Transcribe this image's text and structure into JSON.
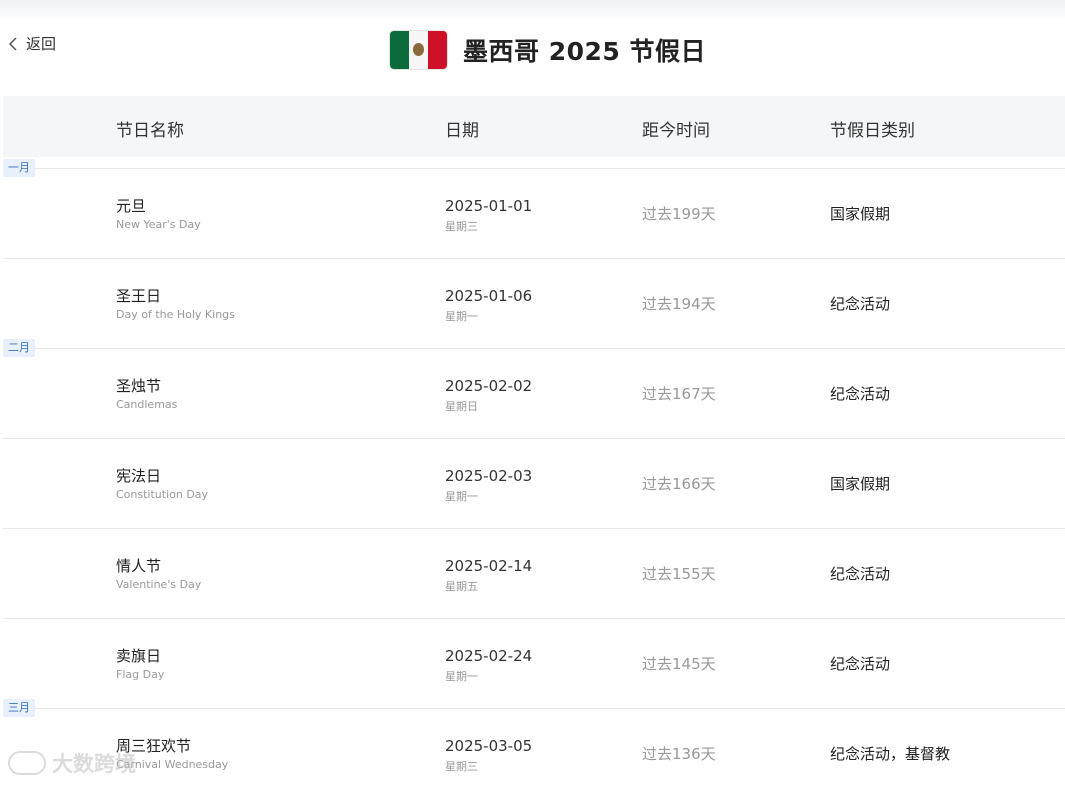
{
  "header": {
    "back_label": "返回",
    "title": "墨西哥 2025 节假日",
    "flag_colors": [
      "#0b6b3a",
      "#f7f7f7",
      "#ce1126"
    ]
  },
  "table": {
    "columns": [
      "节日名称",
      "日期",
      "距今时间",
      "节假日类别"
    ],
    "rows": [
      {
        "name": "元旦",
        "en": "New Year's Day",
        "date": "2025-01-01",
        "weekday": "星期三",
        "ago": "过去199天",
        "type": "国家假期"
      },
      {
        "name": "圣王日",
        "en": "Day of the Holy Kings",
        "date": "2025-01-06",
        "weekday": "星期一",
        "ago": "过去194天",
        "type": "纪念活动"
      },
      {
        "name": "圣烛节",
        "en": "Candlemas",
        "date": "2025-02-02",
        "weekday": "星期日",
        "ago": "过去167天",
        "type": "纪念活动"
      },
      {
        "name": "宪法日",
        "en": "Constitution Day",
        "date": "2025-02-03",
        "weekday": "星期一",
        "ago": "过去166天",
        "type": "国家假期"
      },
      {
        "name": "情人节",
        "en": "Valentine's Day",
        "date": "2025-02-14",
        "weekday": "星期五",
        "ago": "过去155天",
        "type": "纪念活动"
      },
      {
        "name": "卖旗日",
        "en": "Flag Day",
        "date": "2025-02-24",
        "weekday": "星期一",
        "ago": "过去145天",
        "type": "纪念活动"
      },
      {
        "name": "周三狂欢节",
        "en": "Carnival Wednesday",
        "date": "2025-03-05",
        "weekday": "星期三",
        "ago": "过去136天",
        "type": "纪念活动，基督教"
      }
    ]
  },
  "months": [
    "一月",
    "二月",
    "三月"
  ],
  "watermark": "大数跨境"
}
